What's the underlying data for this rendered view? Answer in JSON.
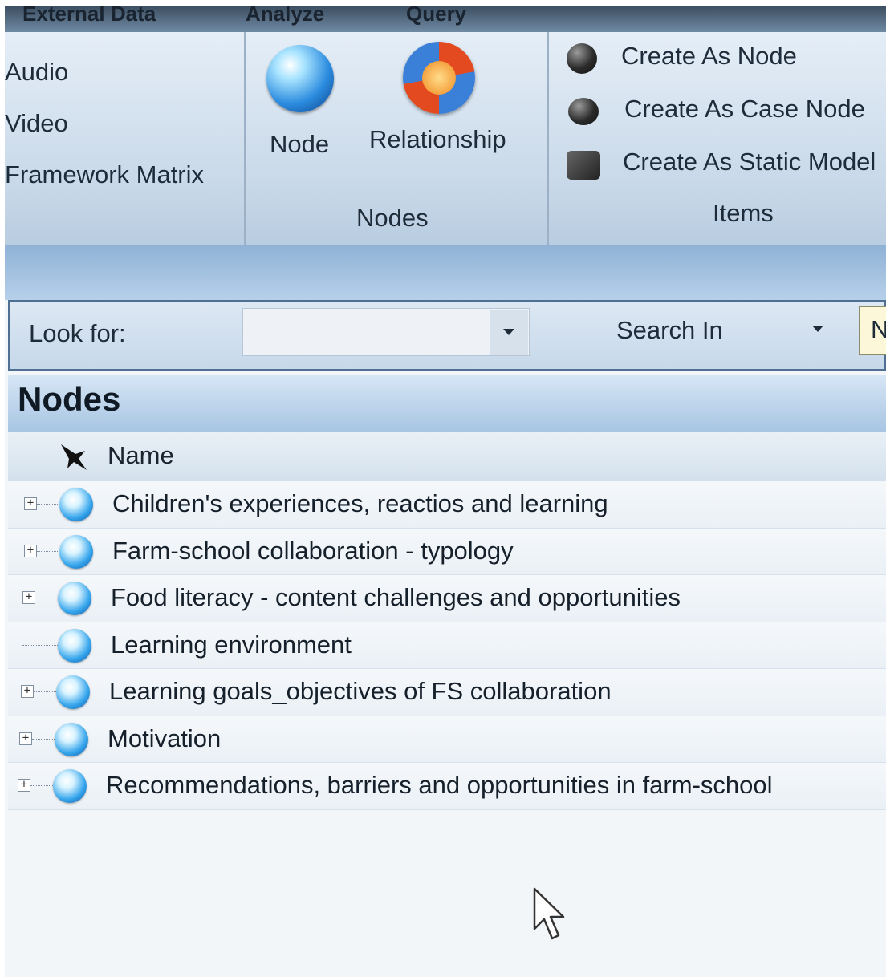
{
  "tabs": [
    "External Data",
    "Analyze",
    "Query"
  ],
  "ribbon": {
    "create_group": {
      "items": [
        "Audio",
        "Video",
        "Framework Matrix"
      ]
    },
    "nodes_group": {
      "node_label": "Node",
      "relationship_label": "Relationship",
      "group_label": "Nodes",
      "node_icon": "node-orb-icon",
      "relationship_icon": "relationship-icon"
    },
    "items_group": {
      "items": [
        "Create As Node",
        "Create As Case Node",
        "Create As Static Model"
      ],
      "group_label": "Items"
    }
  },
  "find_bar": {
    "look_for_label": "Look for:",
    "look_for_value": "",
    "search_in_label": "Search In",
    "find_now_label": "N"
  },
  "nodes_panel": {
    "title": "Nodes",
    "column_name": "Name",
    "rows": [
      {
        "label": "Children's experiences, reactios and learning",
        "expandable": true
      },
      {
        "label": "Farm-school collaboration - typology",
        "expandable": true
      },
      {
        "label": "Food literacy - content challenges and opportunities",
        "expandable": true
      },
      {
        "label": "Learning environment",
        "expandable": false
      },
      {
        "label": "Learning goals_objectives of FS collaboration",
        "expandable": true
      },
      {
        "label": "Motivation",
        "expandable": true
      },
      {
        "label": "Recommendations, barriers and opportunities in farm-school",
        "expandable": true
      }
    ]
  },
  "colors": {
    "ribbon_bg": "#c9d9e9",
    "header_blue": "#a8c5e3",
    "text": "#15202b"
  }
}
